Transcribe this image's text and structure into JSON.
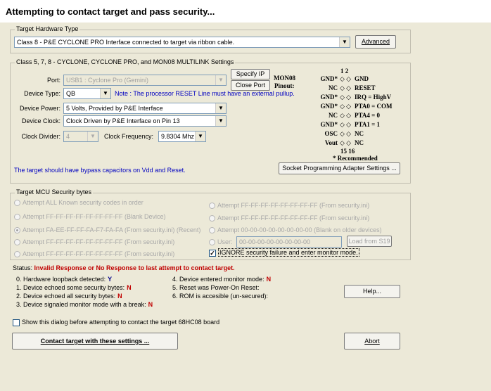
{
  "window": {
    "title": "Attempting to contact target and pass security..."
  },
  "hardware": {
    "legend": "Target Hardware Type",
    "selected": "Class 8 - P&E CYCLONE PRO Interface connected to target via ribbon cable.",
    "advanced": "Advanced"
  },
  "settings": {
    "legend": "Class 5, 7, 8 - CYCLONE, CYCLONE PRO, and MON08 MULTILINK Settings",
    "port_label": "Port:",
    "port_value": "USB1 : Cyclone Pro (Gemini)",
    "specify_ip": "Specify IP",
    "close_port": "Close Port",
    "device_type_label": "Device Type:",
    "device_type_value": "QB",
    "note": "Note : The processor RESET Line must have an external pullup.",
    "device_power_label": "Device Power:",
    "device_power_value": "5 Volts, Provided by P&E Interface",
    "device_clock_label": "Device Clock:",
    "device_clock_value": "Clock Driven by P&E Interface on Pin 13",
    "clock_divider_label": "Clock Divider:",
    "clock_divider_value": "4",
    "clock_freq_label": "Clock Frequency:",
    "clock_freq_value": "9.8304 Mhz",
    "bypass_note": "The target should have bypass capacitors on Vdd and Reset.",
    "socket_button": "Socket Programming Adapter Settings ..."
  },
  "pinout": {
    "title1": "MON08",
    "title2": "Pinout:",
    "col_header": "1  2",
    "rows": [
      {
        "left": "GND*",
        "right": "GND"
      },
      {
        "left": "NC",
        "right": "RESET"
      },
      {
        "left": "GND*",
        "right": "IRQ = HighV"
      },
      {
        "left": "GND*",
        "right": "PTA0 = COM"
      },
      {
        "left": "NC",
        "right": "PTA4 = 0"
      },
      {
        "left": "GND*",
        "right": "PTA1 = 1"
      },
      {
        "left": "OSC",
        "right": "NC"
      },
      {
        "left": "Vout",
        "right": "NC"
      }
    ],
    "footer_header": "15 16",
    "recommended": "* Recommended",
    "dots": "◇ ◇"
  },
  "security": {
    "legend": "Target MCU Security bytes",
    "left_options": [
      "Attempt ALL Known security codes in order",
      "Attempt FF-FF-FF-FF-FF-FF-FF-FF (Blank Device)",
      "Attempt FA-EE-FF-FF-FA-F7-FA-FA (From security.ini) (Recent)",
      "Attempt FF-FF-FF-FF-FF-FF-FF-FF (From security.ini)",
      "Attempt FF-FF-FF-FF-FF-FF-FF-FF (From security.ini)"
    ],
    "right_options": [
      "Attempt FF-FF-FF-FF-FF-FF-FF-FF (From security.ini)",
      "Attempt FF-FF-FF-FF-FF-FF-FF-FF (From security.ini)",
      "Attempt 00-00-00-00-00-00-00-00 (Blank on older devices)"
    ],
    "user_label": "User:",
    "user_value": "00-00-00-00-00-00-00-00",
    "load_s19": "Load from S19",
    "ignore_label": "IGNORE security failure and enter monitor mode."
  },
  "status": {
    "prefix": "Status:",
    "message": "Invalid Response or No Response to last attempt to contact target.",
    "left_items": [
      {
        "label": "0. Hardware loopback detected:",
        "value": "Y"
      },
      {
        "label": "1. Device echoed some security bytes:",
        "value": "N"
      },
      {
        "label": "2. Device echoed all security bytes:",
        "value": "N"
      },
      {
        "label": "3. Device signaled monitor mode with a break:",
        "value": "N"
      }
    ],
    "right_items": [
      {
        "label": "4. Device entered monitor mode:",
        "value": "N"
      },
      {
        "label": "5. Reset was Power-On Reset:",
        "value": ""
      },
      {
        "label": "6. ROM is accesible (un-secured):",
        "value": ""
      }
    ]
  },
  "help": "Help...",
  "show_dialog": "Show this dialog before attempting to contact the target 68HC08 board",
  "contact": "Contact target with these settings ...",
  "abort": "Abort"
}
